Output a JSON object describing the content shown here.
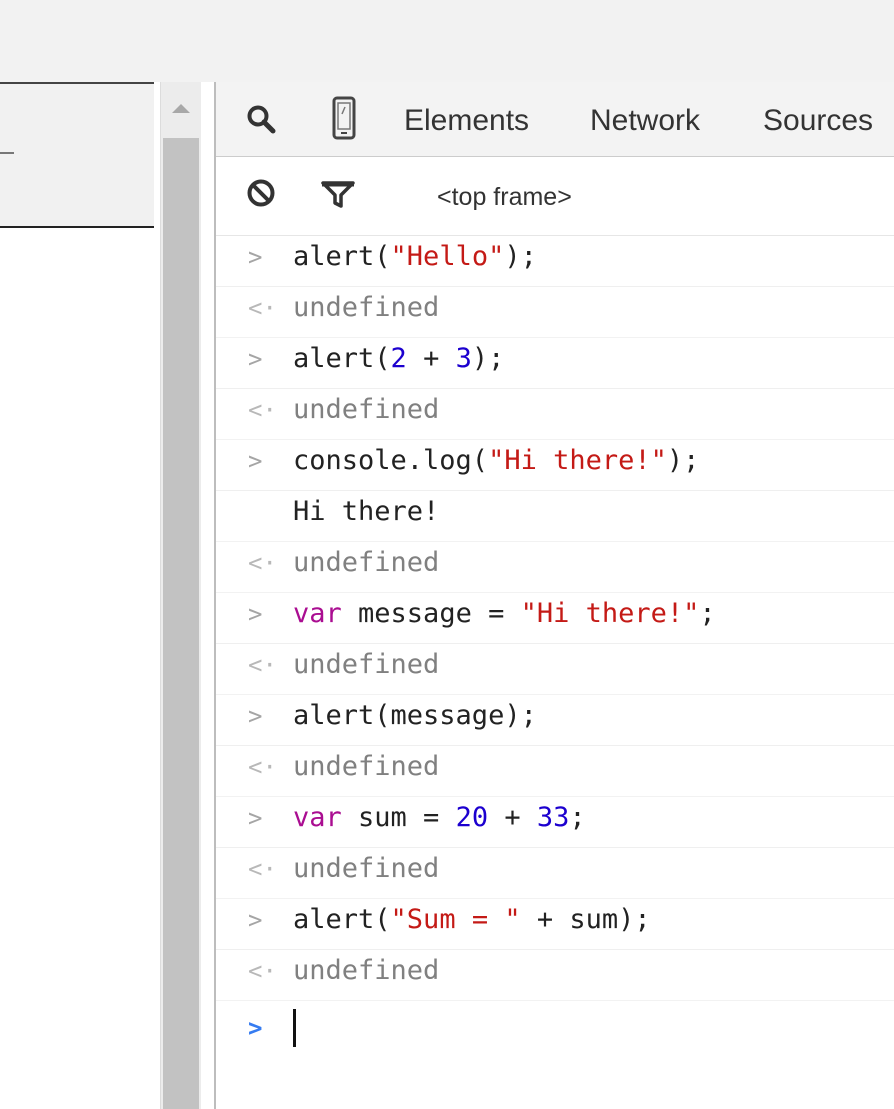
{
  "devtools": {
    "tabs": [
      "Elements",
      "Network",
      "Sources"
    ],
    "frame_select": "<top frame>",
    "icons": [
      "search-icon",
      "device-mode-icon",
      "clear-console-icon",
      "filter-icon"
    ]
  },
  "console": {
    "input_prefix": ">",
    "result_prefix": "<·",
    "result_value": "undefined",
    "entries": [
      {
        "type": "input",
        "parts": [
          [
            "t",
            "alert("
          ],
          [
            "s",
            "\"Hello\""
          ],
          [
            "t",
            ");"
          ]
        ]
      },
      {
        "type": "result",
        "text": "undefined"
      },
      {
        "type": "input",
        "parts": [
          [
            "t",
            "alert("
          ],
          [
            "n",
            "2"
          ],
          [
            "t",
            " + "
          ],
          [
            "n",
            "3"
          ],
          [
            "t",
            ");"
          ]
        ]
      },
      {
        "type": "result",
        "text": "undefined"
      },
      {
        "type": "input",
        "parts": [
          [
            "t",
            "console.log("
          ],
          [
            "s",
            "\"Hi there!\""
          ],
          [
            "t",
            ");"
          ]
        ]
      },
      {
        "type": "log",
        "text": "Hi there!"
      },
      {
        "type": "result",
        "text": "undefined"
      },
      {
        "type": "input",
        "parts": [
          [
            "k",
            "var"
          ],
          [
            "t",
            " message = "
          ],
          [
            "s",
            "\"Hi there!\""
          ],
          [
            "t",
            ";"
          ]
        ]
      },
      {
        "type": "result",
        "text": "undefined"
      },
      {
        "type": "input",
        "parts": [
          [
            "t",
            "alert(message);"
          ]
        ]
      },
      {
        "type": "result",
        "text": "undefined"
      },
      {
        "type": "input",
        "parts": [
          [
            "k",
            "var"
          ],
          [
            "t",
            " sum = "
          ],
          [
            "n",
            "20"
          ],
          [
            "t",
            " + "
          ],
          [
            "n",
            "33"
          ],
          [
            "t",
            ";"
          ]
        ]
      },
      {
        "type": "result",
        "text": "undefined"
      },
      {
        "type": "input",
        "parts": [
          [
            "t",
            "alert("
          ],
          [
            "s",
            "\"Sum = \""
          ],
          [
            "t",
            " + sum);"
          ]
        ]
      },
      {
        "type": "result",
        "text": "undefined"
      }
    ],
    "prompt_prefix": ">"
  },
  "colors": {
    "string": "#c41a16",
    "number": "#1c00cf",
    "keyword": "#aa0d91",
    "prompt": "#367cf1"
  }
}
